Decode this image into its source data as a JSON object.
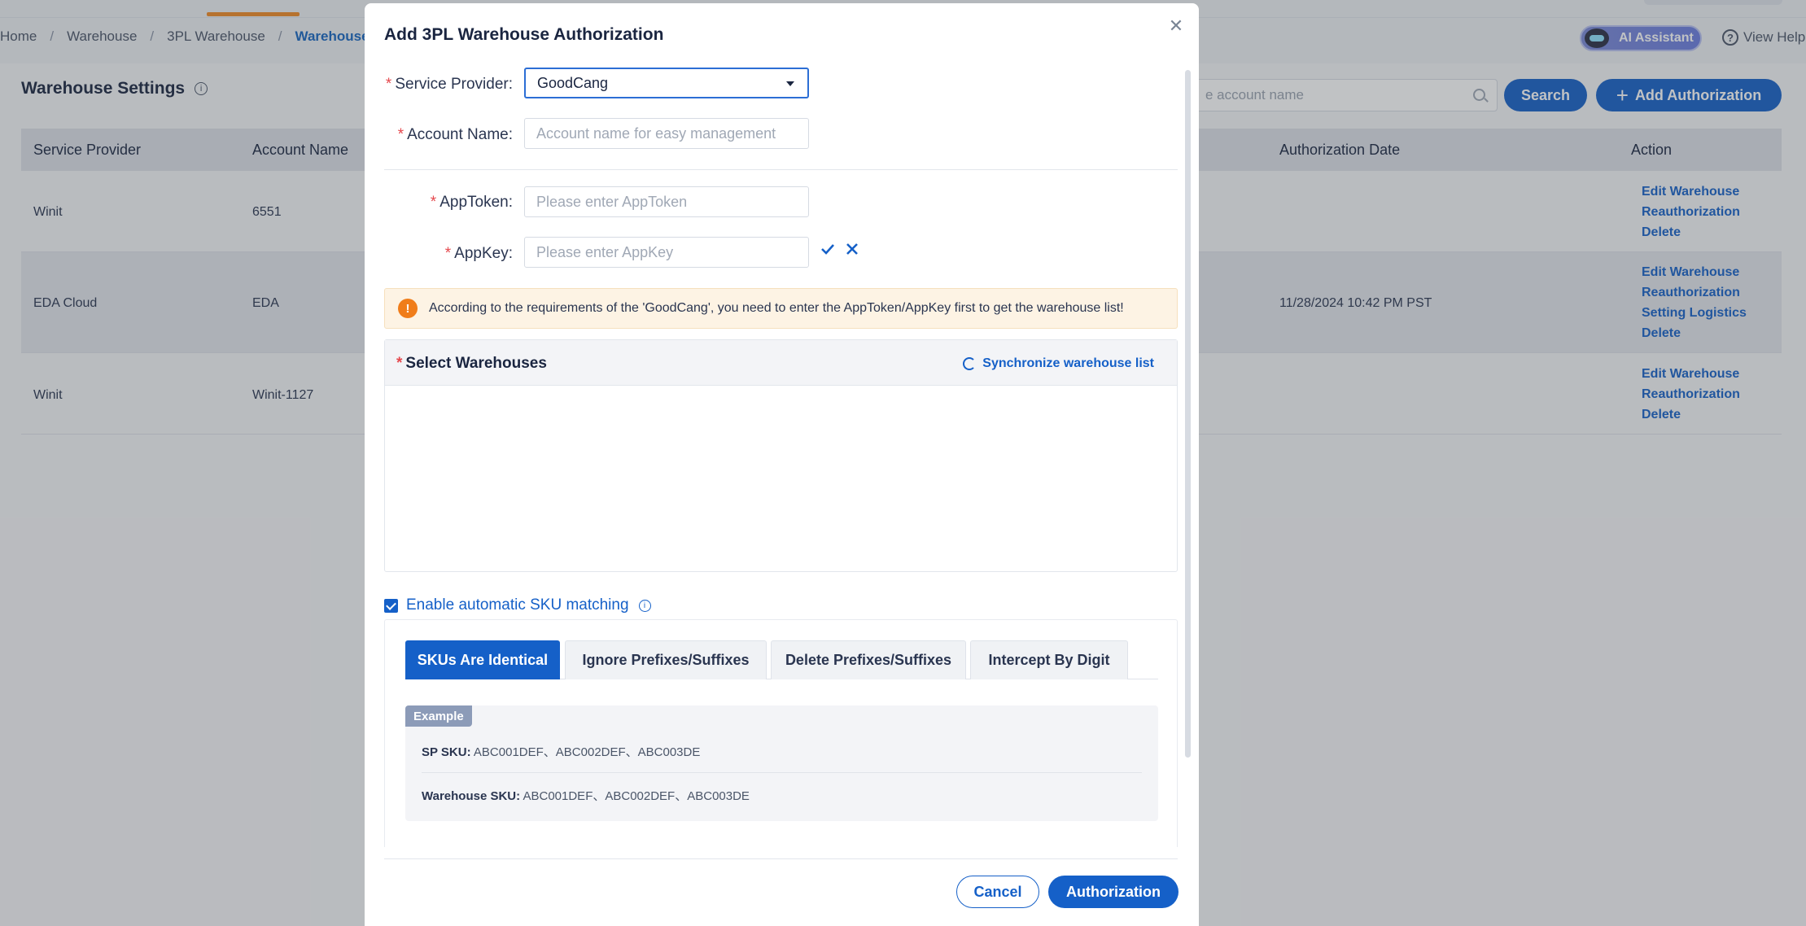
{
  "breadcrumb": [
    "Home",
    "Warehouse",
    "3PL Warehouse",
    "Warehouse Set"
  ],
  "header": {
    "ai_assistant": "AI Assistant",
    "view_help": "View Help"
  },
  "page": {
    "title": "Warehouse Settings",
    "search_placeholder": "e account name",
    "search_button": "Search",
    "add_button": "Add Authorization"
  },
  "table": {
    "columns": [
      "Service Provider",
      "Account Name",
      "Authorization Date",
      "Action"
    ],
    "rows": [
      {
        "provider": "Winit",
        "account": "6551",
        "date": "",
        "actions": [
          "Edit Warehouse",
          "Reauthorization",
          "Delete"
        ]
      },
      {
        "provider": "EDA Cloud",
        "account": "EDA",
        "date": "11/28/2024 10:42 PM PST",
        "actions": [
          "Edit Warehouse",
          "Reauthorization",
          "Setting Logistics",
          "Delete"
        ]
      },
      {
        "provider": "Winit",
        "account": "Winit-1127",
        "date": "",
        "actions": [
          "Edit Warehouse",
          "Reauthorization",
          "Delete"
        ]
      }
    ]
  },
  "modal": {
    "title": "Add 3PL Warehouse Authorization",
    "service_provider_label": "Service Provider:",
    "service_provider_value": "GoodCang",
    "account_name_label": "Account Name:",
    "account_name_placeholder": "Account name for easy management",
    "apptoken_label": "AppToken:",
    "apptoken_placeholder": "Please enter AppToken",
    "appkey_label": "AppKey:",
    "appkey_placeholder": "Please enter AppKey",
    "alert_text": "According to the requirements of the 'GoodCang', you need to enter the AppToken/AppKey first to get the warehouse list!",
    "select_warehouses_label": "Select Warehouses",
    "sync_label": "Synchronize warehouse list",
    "sku_matching_label": "Enable automatic SKU matching",
    "tabs": [
      "SKUs Are Identical",
      "Ignore Prefixes/Suffixes",
      "Delete Prefixes/Suffixes",
      "Intercept By Digit"
    ],
    "example_tag": "Example",
    "sp_sku_label": "SP SKU:",
    "sp_sku_value": "ABC001DEF、ABC002DEF、ABC003DE",
    "warehouse_sku_label": "Warehouse SKU:",
    "warehouse_sku_value": "ABC001DEF、ABC002DEF、ABC003DE",
    "cancel": "Cancel",
    "authorize": "Authorization"
  },
  "colors": {
    "primary": "#1560c8",
    "warning": "#f07d1a",
    "accent": "#f08a24"
  }
}
